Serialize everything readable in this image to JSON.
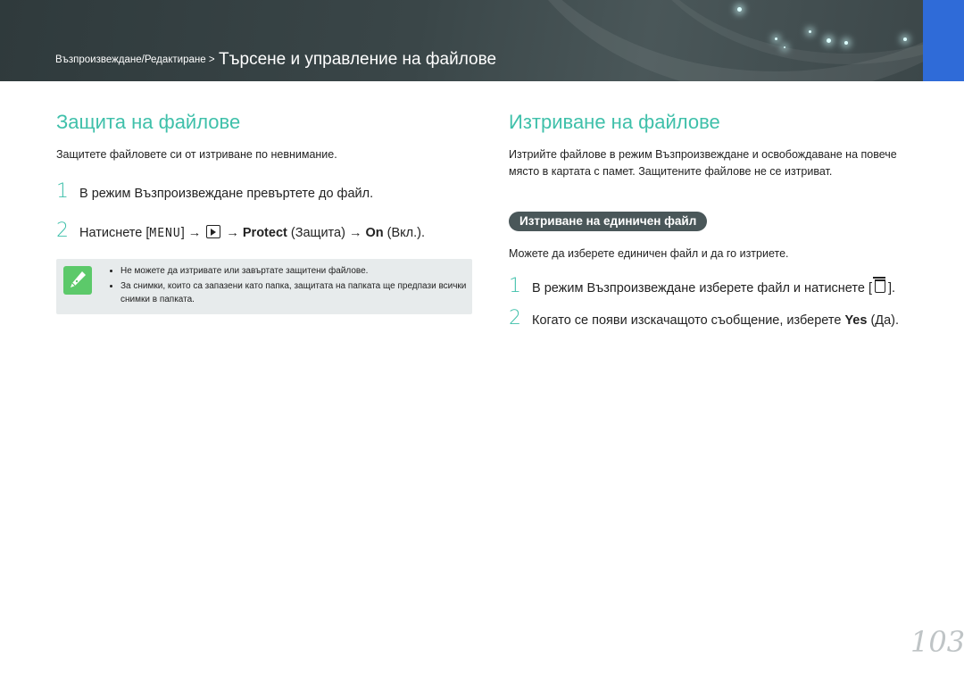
{
  "header": {
    "breadcrumb_small": "Възпроизвеждане/Редактиране >",
    "breadcrumb_big": "Търсене и управление на файлове"
  },
  "left": {
    "title": "Защита на файлове",
    "intro": "Защитете файловете си от изтриване по невнимание.",
    "step1_num": "1",
    "step1_text": "В режим Възпроизвеждане превъртете до файл.",
    "step2_num": "2",
    "step2_pre": "Натиснете [",
    "step2_menu": "MENU",
    "step2_mid": "] →",
    "step2_arrow": "→",
    "step2_protect": "Protect",
    "step2_protect_bg": " (Защита) →",
    "step2_on": "On",
    "step2_on_bg": " (Вкл.).",
    "note": {
      "icon": "pencil-note-icon",
      "items": [
        "Не можете да изтривате или завъртате защитени файлове.",
        "За снимки, които са запазени като папка, защитата на папката ще предпази всички снимки в папката."
      ]
    }
  },
  "right": {
    "title": "Изтриване на файлове",
    "intro": "Изтрийте файлове в режим Възпроизвеждане и освобождаване на повече място в картата с памет. Защитените файлове не се изтриват.",
    "pill": "Изтриване на единичен файл",
    "sub_intro": "Можете да изберете единичен файл и да го изтриете.",
    "step1_num": "1",
    "step1_text": "В режим Възпроизвеждане изберете файл и натиснете [",
    "step1_end": "].",
    "step2_num": "2",
    "step2_text": "Когато се появи изскачащото съобщение, изберете ",
    "step2_yes": "Yes",
    "step2_end": " (Да)."
  },
  "page_number": "103",
  "colors": {
    "accent": "#3fc0aa",
    "tab": "#2f6bd8",
    "header": "#3a4648"
  }
}
